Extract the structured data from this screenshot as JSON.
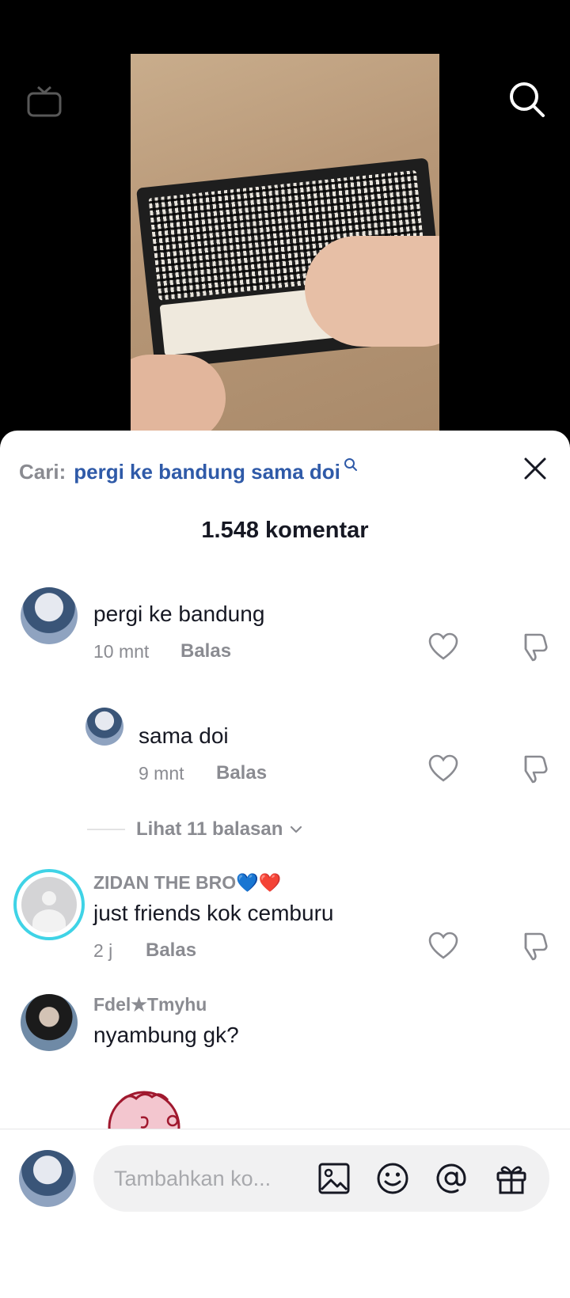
{
  "sheet": {
    "search_prefix": "Cari:",
    "search_query": "pergi ke bandung sama doi",
    "count_title": "1.548 komentar"
  },
  "comments": [
    {
      "username": "",
      "text": "pergi ke bandung",
      "time": "10 mnt",
      "reply": "Balas"
    },
    {
      "username": "",
      "text": "sama doi",
      "time": "9 mnt",
      "reply": "Balas"
    },
    {
      "username": "ZIDAN THE BRO💙❤️",
      "text": "just friends kok cemburu",
      "time": "2 j",
      "reply": "Balas"
    },
    {
      "username": "Fdel★Tmyhu",
      "text": "nyambung gk?"
    }
  ],
  "view_replies": "Lihat 11 balasan",
  "input": {
    "placeholder": "Tambahkan ko..."
  },
  "colors": {
    "link": "#2f5aa8",
    "ring": "#3fd3e6",
    "muted": "#8a8b91"
  },
  "icons": [
    "live-icon",
    "search-icon",
    "close-icon",
    "heart-icon",
    "dislike-icon",
    "image-icon",
    "emoji-icon",
    "mention-icon",
    "gift-icon"
  ]
}
